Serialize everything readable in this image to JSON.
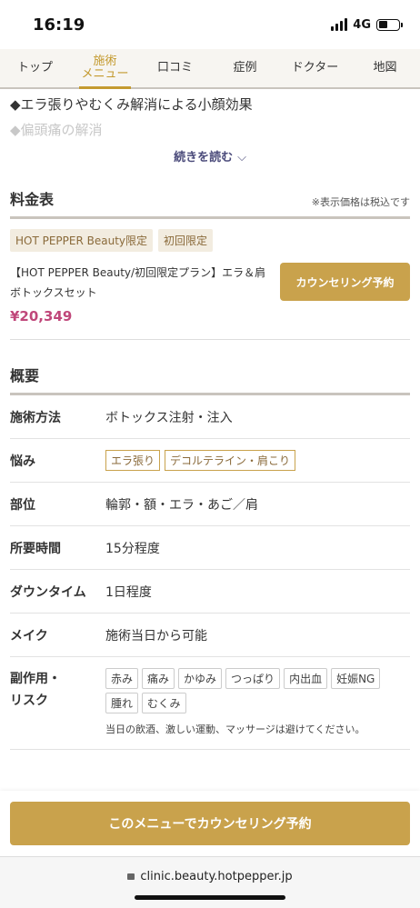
{
  "status": {
    "time": "16:19",
    "network": "4G"
  },
  "tabs": [
    {
      "label": "トップ"
    },
    {
      "label": "施術\nメニュー"
    },
    {
      "label": "口コミ"
    },
    {
      "label": "症例"
    },
    {
      "label": "ドクター"
    },
    {
      "label": "地図"
    }
  ],
  "intro": {
    "line1": "◆エラ張りやむくみ解消による小顔効果",
    "line2": "◆偏頭痛の解消",
    "read_more": "続きを読む"
  },
  "price_table": {
    "title": "料金表",
    "note": "※表示価格は税込です",
    "tags": [
      "HOT PEPPER Beauty限定",
      "初回限定"
    ],
    "plan_name": "【HOT PEPPER Beauty/初回限定プラン】エラ＆肩ボトックスセット",
    "price": "¥20,349",
    "reserve_label": "カウンセリング予約"
  },
  "overview": {
    "title": "概要",
    "method_label": "施術方法",
    "method_value": "ボトックス注射・注入",
    "concern_label": "悩み",
    "concern_tags": [
      "エラ張り",
      "デコルテライン・肩こり"
    ],
    "area_label": "部位",
    "area_value": "輪郭・額・エラ・あご／肩",
    "time_label": "所要時間",
    "time_value": "15分程度",
    "downtime_label": "ダウンタイム",
    "downtime_value": "1日程度",
    "makeup_label": "メイク",
    "makeup_value": "施術当日から可能",
    "risk_label": "副作用・\nリスク",
    "risk_tags": [
      "赤み",
      "痛み",
      "かゆみ",
      "つっぱり",
      "内出血",
      "妊娠NG",
      "腫れ",
      "むくみ"
    ],
    "risk_note": "当日の飲酒、激しい運動、マッサージは避けてください。"
  },
  "cta": {
    "label": "このメニューでカウンセリング予約"
  },
  "browser": {
    "url": "clinic.beauty.hotpepper.jp"
  },
  "colors": {
    "accent": "#c9a24c",
    "price": "#c0477a",
    "active_tab": "#c49a2f"
  }
}
